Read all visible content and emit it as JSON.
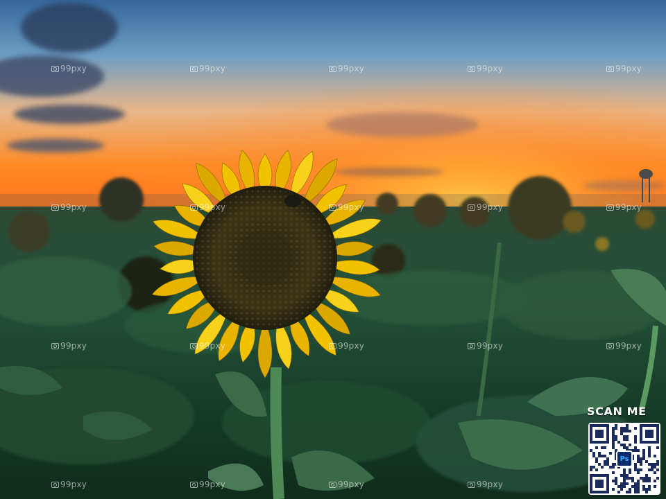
{
  "watermark": {
    "text": "@99pxy",
    "icon": "camera-icon"
  },
  "qr": {
    "label": "SCAN ME",
    "badge_text": "Ps"
  },
  "colors": {
    "sky_top": "#3f6b9c",
    "sunset_orange": "#ff7a1a",
    "petal_yellow": "#f2c200",
    "leaf_green": "#2a5a36"
  }
}
